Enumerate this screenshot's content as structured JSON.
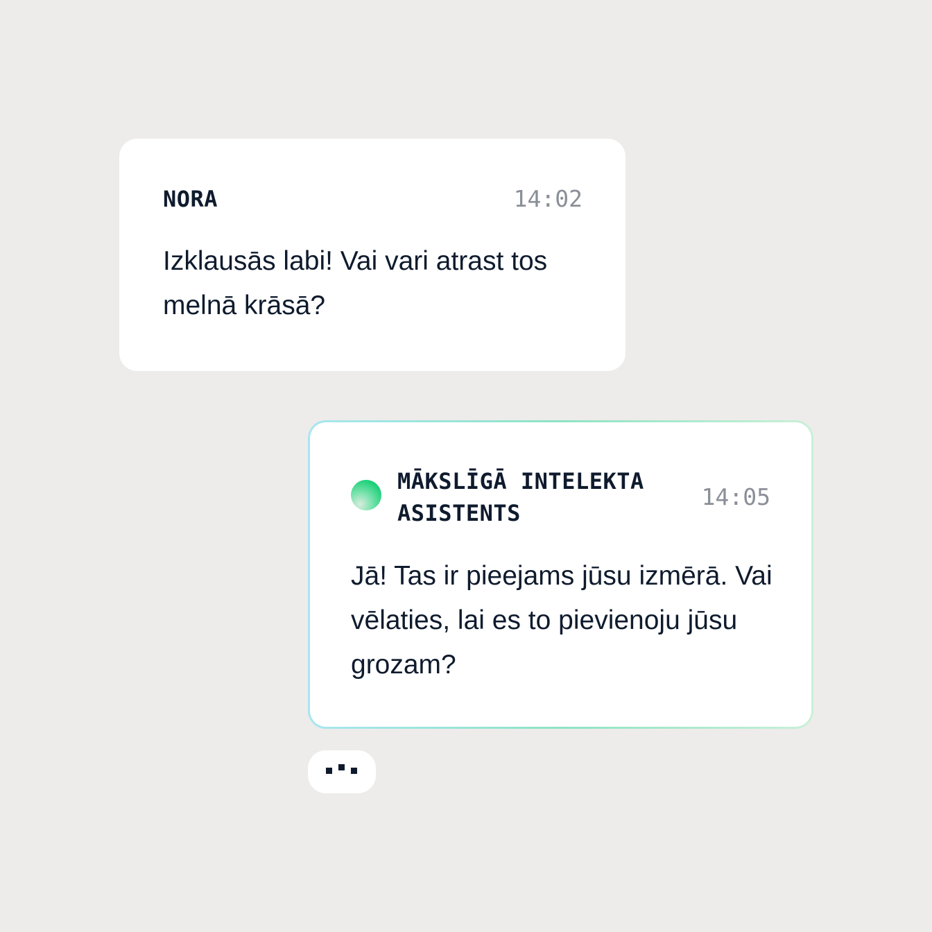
{
  "messages": [
    {
      "sender": "NORA",
      "time": "14:02",
      "text": "Izklausās labi! Vai vari atrast tos melnā krāsā?"
    },
    {
      "sender": "MĀKSLĪGĀ INTELEKTA ASISTENTS",
      "time": "14:05",
      "text": "Jā! Tas ir pieejams jūsu izmērā. Vai vēlaties, lai es to pievienoju jūsu grozam?"
    }
  ],
  "colors": {
    "background": "#edecea",
    "bubble": "#ffffff",
    "text": "#0f1b2d",
    "timestamp": "#8a8f97",
    "ai_accent": "#1fd17a"
  },
  "icons": {
    "assistant_avatar": "gradient-orb-icon",
    "typing_indicator": "typing-dots-icon"
  }
}
